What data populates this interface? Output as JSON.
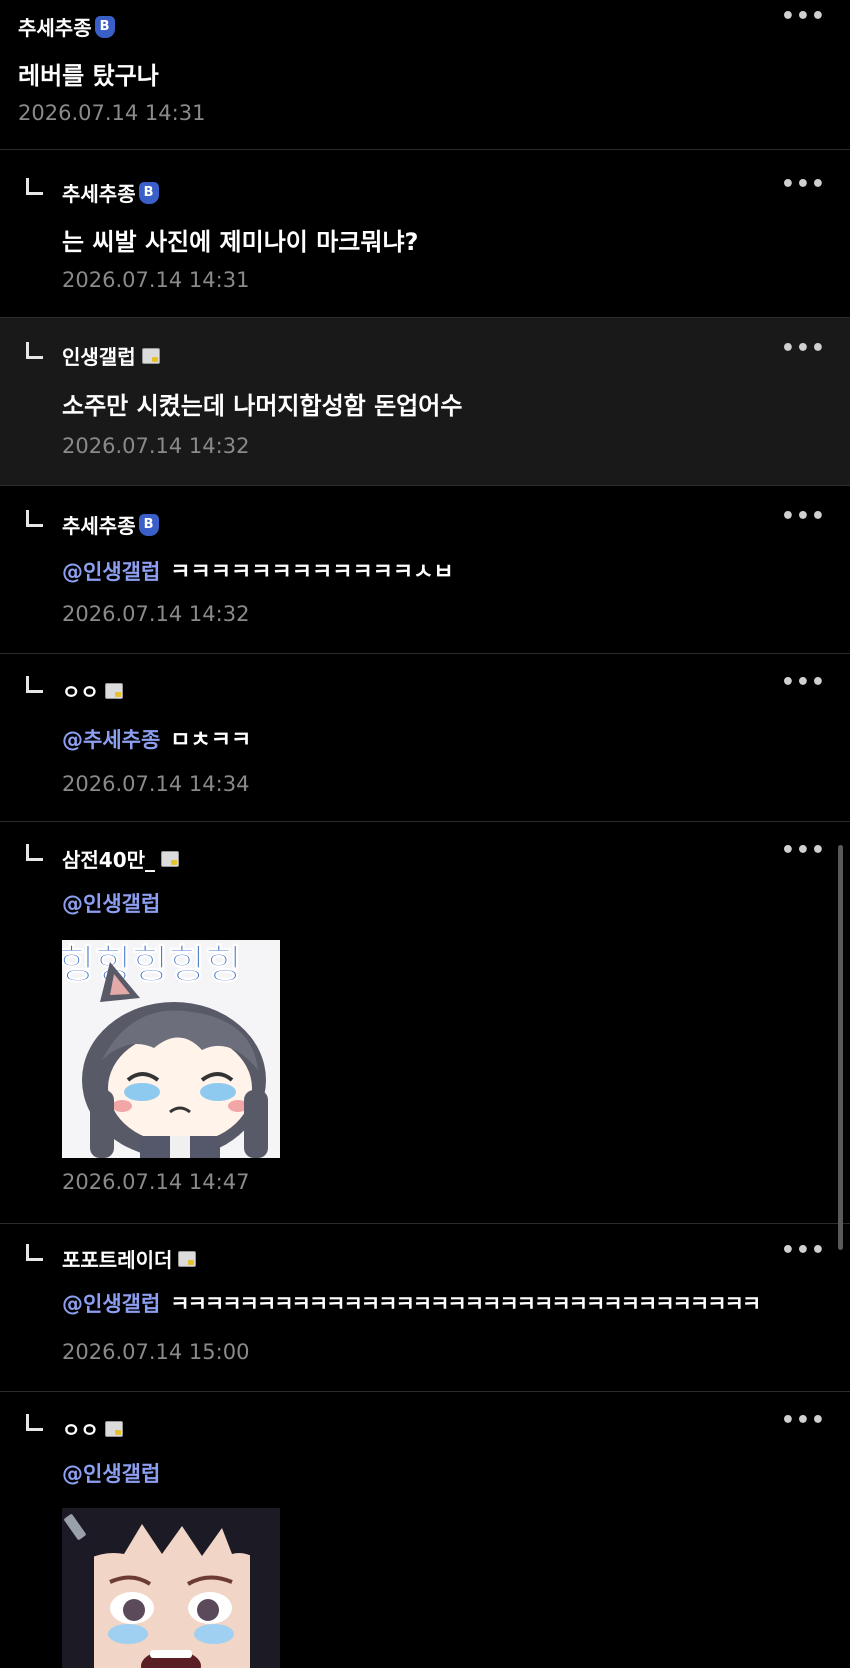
{
  "top_comment": {
    "author": "추세추종",
    "badge": "B",
    "text": "레버를 탔구나",
    "time": "2026.07.14 14:31"
  },
  "replies": [
    {
      "author": "추세추종",
      "badge": "B",
      "text": "는 씨발 사진에 제미나이 마크뭐냐?",
      "time": "2026.07.14 14:31"
    },
    {
      "author": "인생갤럽",
      "text": "소주만 시켰는데 나머지합성함 돈업어수",
      "time": "2026.07.14 14:32"
    },
    {
      "author": "추세추종",
      "badge": "B",
      "mention": "@인생갤럽",
      "text": "ㅋㅋㅋㅋㅋㅋㅋㅋㅋㅋㅋㅋㅅㅂ",
      "time": "2026.07.14 14:32"
    },
    {
      "author": "ㅇㅇ",
      "mention": "@추세추종",
      "text": "ㅁㅊㅋㅋ",
      "time": "2026.07.14 14:34"
    },
    {
      "author": "삼전40만_",
      "mention": "@인생갤럽",
      "sticker_text": "힝힝힝힝힝",
      "time": "2026.07.14 14:47"
    },
    {
      "author": "포포트레이더",
      "mention": "@인생갤럽",
      "text": "ㅋㅋㅋㅋㅋㅋㅋㅋㅋㅋㅋㅋㅋㅋㅋㅋㅋㅋㅋㅋㅋㅋㅋㅋㅋㅋㅋㅋㅋㅋㅋㅋㅋㅋ",
      "time": "2026.07.14 15:00"
    },
    {
      "author": "ㅇㅇ",
      "mention": "@인생갤럽"
    }
  ],
  "more_icon": "•••",
  "colors": {
    "background": "#000000",
    "highlight_background": "#191919",
    "mention": "#8d9ff0",
    "timestamp": "#8a8a8a",
    "badge_blue": "#3a5fc8"
  },
  "icons": [
    "more-icon",
    "reply-arrow-icon",
    "b-badge-icon",
    "image-badge-icon"
  ]
}
